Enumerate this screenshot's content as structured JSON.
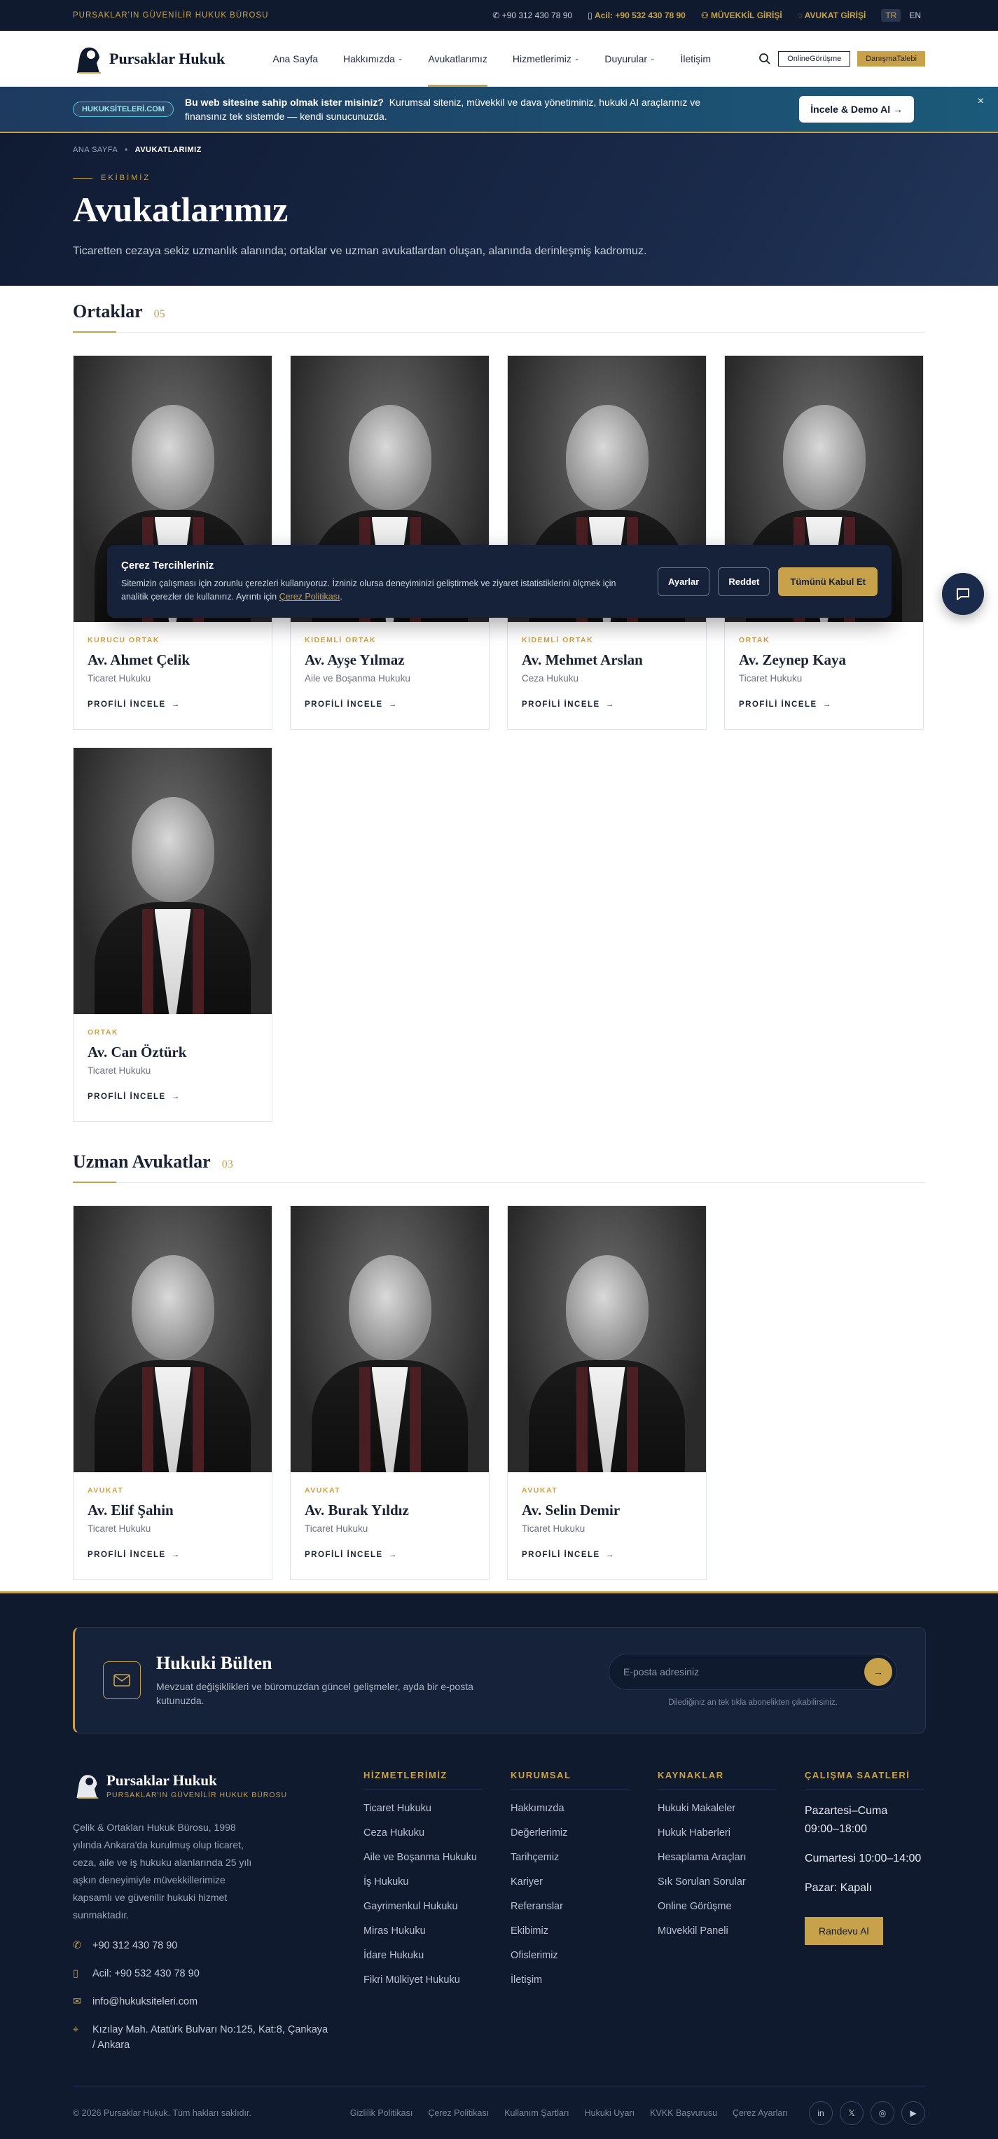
{
  "topbar": {
    "tagline": "PURSAKLAR'IN GÜVENİLİR HUKUK BÜROSU",
    "phone": "+90 312 430 78 90",
    "urgent_label": "Acil:",
    "urgent_phone": "+90 532 430 78 90",
    "client_login": "MÜVEKKİL GİRİŞİ",
    "lawyer_login": "AVUKAT GİRİŞİ",
    "lang_tr": "TR",
    "lang_en": "EN"
  },
  "header": {
    "brand": "Pursaklar Hukuk",
    "nav": [
      "Ana Sayfa",
      "Hakkımızda",
      "Avukatlarımız",
      "Hizmetlerimiz",
      "Duyurular",
      "İletişim"
    ],
    "online_btn": "OnlineGörüşme",
    "consult_btn": "DanışmaTalebi"
  },
  "promo": {
    "pill": "HUKUKSİTELERİ.COM",
    "question": "Bu web sitesine sahip olmak ister misiniz?",
    "message": "Kurumsal siteniz, müvekkil ve dava yönetiminiz, hukuki AI araçlarınız ve finansınız tek sistemde — kendi sunucunuzda.",
    "cta": "İncele & Demo Al",
    "close": "×"
  },
  "hero": {
    "crumb_home": "ANA SAYFA",
    "crumb_current": "AVUKATLARIMIZ",
    "eyebrow": "EKİBİMİZ",
    "title": "Avukatlarımız",
    "subtitle": "Ticaretten cezaya sekiz uzmanlık alanında; ortaklar ve uzman avukatlardan oluşan, alanında derinleşmiş kadromuz."
  },
  "partners": {
    "title": "Ortaklar",
    "count": "05",
    "items": [
      {
        "role": "KURUCU ORTAK",
        "name": "Av. Ahmet Çelik",
        "area": "Ticaret Hukuku",
        "more": "PROFİLİ İNCELE"
      },
      {
        "role": "KIDEMLİ ORTAK",
        "name": "Av. Ayşe Yılmaz",
        "area": "Aile ve Boşanma Hukuku",
        "more": "PROFİLİ İNCELE"
      },
      {
        "role": "KIDEMLİ ORTAK",
        "name": "Av. Mehmet Arslan",
        "area": "Ceza Hukuku",
        "more": "PROFİLİ İNCELE"
      },
      {
        "role": "ORTAK",
        "name": "Av. Zeynep Kaya",
        "area": "Ticaret Hukuku",
        "more": "PROFİLİ İNCELE"
      },
      {
        "role": "ORTAK",
        "name": "Av. Can Öztürk",
        "area": "Ticaret Hukuku",
        "more": "PROFİLİ İNCELE"
      }
    ]
  },
  "experts": {
    "title": "Uzman Avukatlar",
    "count": "03",
    "items": [
      {
        "role": "AVUKAT",
        "name": "Av. Elif Şahin",
        "area": "Ticaret Hukuku",
        "more": "PROFİLİ İNCELE"
      },
      {
        "role": "AVUKAT",
        "name": "Av. Burak Yıldız",
        "area": "Ticaret Hukuku",
        "more": "PROFİLİ İNCELE"
      },
      {
        "role": "AVUKAT",
        "name": "Av. Selin Demir",
        "area": "Ticaret Hukuku",
        "more": "PROFİLİ İNCELE"
      }
    ]
  },
  "cookie": {
    "title": "Çerez Tercihleriniz",
    "text": "Sitemizin çalışması için zorunlu çerezleri kullanıyoruz. İzniniz olursa deneyiminizi geliştirmek ve ziyaret istatistiklerini ölçmek için analitik çerezler de kullanırız. Ayrıntı için",
    "policy_link": "Çerez Politikası",
    "settings": "Ayarlar",
    "reject": "Reddet",
    "accept": "Tümünü Kabul Et"
  },
  "newsletter": {
    "title": "Hukuki Bülten",
    "subtitle": "Mevzuat değişiklikleri ve büromuzdan güncel gelişmeler, ayda bir e-posta kutunuzda.",
    "placeholder": "E-posta adresiniz",
    "note": "Dilediğiniz an tek tıkla abonelikten çıkabilirsiniz."
  },
  "footer": {
    "brand": "Pursaklar Hukuk",
    "brand_sub": "PURSAKLAR'IN GÜVENİLİR HUKUK BÜROSU",
    "about": "Çelik & Ortakları Hukuk Bürosu, 1998 yılında Ankara'da kurulmuş olup ticaret, ceza, aile ve iş hukuku alanlarında 25 yılı aşkın deneyimiyle müvekkillerimize kapsamlı ve güvenilir hukuki hizmet sunmaktadır.",
    "phone": "+90 312 430 78 90",
    "urgent": "Acil: +90 532 430 78 90",
    "email": "info@hukuksiteleri.com",
    "address": "Kızılay Mah. Atatürk Bulvarı No:125, Kat:8, Çankaya / Ankara",
    "col_services_title": "HİZMETLERİMİZ",
    "services": [
      "Ticaret Hukuku",
      "Ceza Hukuku",
      "Aile ve Boşanma Hukuku",
      "İş Hukuku",
      "Gayrimenkul Hukuku",
      "Miras Hukuku",
      "İdare Hukuku",
      "Fikri Mülkiyet Hukuku"
    ],
    "col_corp_title": "KURUMSAL",
    "corp": [
      "Hakkımızda",
      "Değerlerimiz",
      "Tarihçemiz",
      "Kariyer",
      "Referanslar",
      "Ekibimiz",
      "Ofislerimiz",
      "İletişim"
    ],
    "col_res_title": "KAYNAKLAR",
    "resources": [
      "Hukuki Makaleler",
      "Hukuk Haberleri",
      "Hesaplama Araçları",
      "Sık Sorulan Sorular",
      "Online Görüşme",
      "Müvekkil Paneli"
    ],
    "col_hours_title": "ÇALIŞMA SAATLERİ",
    "hours": [
      "Pazartesi–Cuma 09:00–18:00",
      "Cumartesi 10:00–14:00",
      "Pazar: Kapalı"
    ],
    "appointment": "Randevu Al",
    "copyright": "© 2026 Pursaklar Hukuk. Tüm hakları saklıdır.",
    "legal": [
      "Gizlilik Politikası",
      "Çerez Politikası",
      "Kullanım Şartları",
      "Hukuki Uyarı",
      "KVKK Başvurusu",
      "Çerez Ayarları"
    ],
    "social": [
      "in",
      "𝕏",
      "◎",
      "▶"
    ]
  }
}
